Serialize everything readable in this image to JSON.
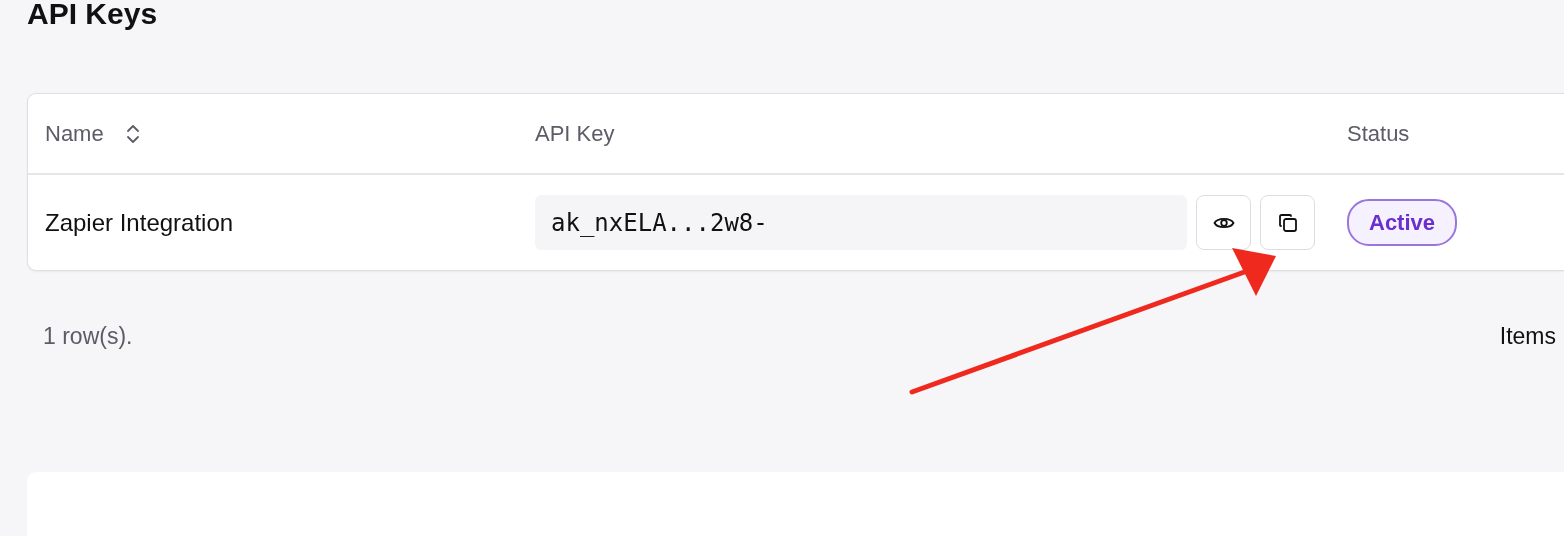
{
  "page": {
    "title": "API Keys"
  },
  "table": {
    "columns": [
      {
        "label": "Name",
        "sortable": true
      },
      {
        "label": "API Key",
        "sortable": false
      },
      {
        "label": "Status",
        "sortable": false
      }
    ],
    "rows": [
      {
        "name": "Zapier Integration",
        "api_key": "ak_nxELA...2w8-",
        "status": "Active"
      }
    ]
  },
  "footer": {
    "row_count": "1 row(s).",
    "items_label": "Items"
  }
}
